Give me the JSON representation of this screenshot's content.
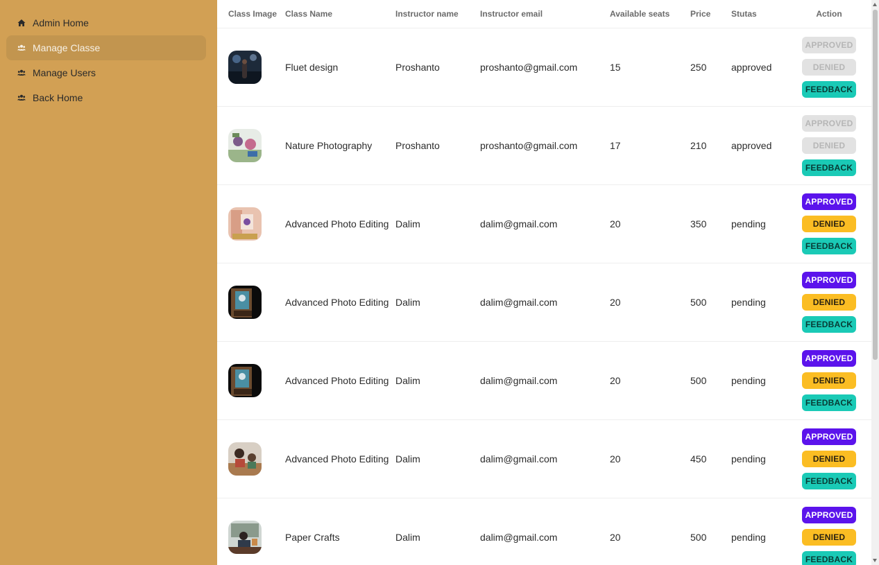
{
  "sidebar": {
    "items": [
      {
        "label": "Admin Home",
        "icon": "home-icon",
        "active": false
      },
      {
        "label": "Manage Classe",
        "icon": "users-icon",
        "active": true
      },
      {
        "label": "Manage Users",
        "icon": "users-icon",
        "active": false
      },
      {
        "label": "Back Home",
        "icon": "users-icon",
        "active": false
      }
    ]
  },
  "table": {
    "headers": [
      "Class Image",
      "Class Name",
      "Instructor name",
      "Instructor email",
      "Available seats",
      "Price",
      "Stutas",
      "Action"
    ],
    "rows": [
      {
        "image": "concert-photo",
        "class_name": "Fluet design",
        "instructor": "Proshanto",
        "email": "proshanto@gmail.com",
        "seats": "15",
        "price": "250",
        "status": "approved"
      },
      {
        "image": "nature-photo",
        "class_name": "Nature Photography",
        "instructor": "Proshanto",
        "email": "proshanto@gmail.com",
        "seats": "17",
        "price": "210",
        "status": "approved"
      },
      {
        "image": "painting-photo",
        "class_name": "Advanced Photo Editing",
        "instructor": "Dalim",
        "email": "dalim@gmail.com",
        "seats": "20",
        "price": "350",
        "status": "pending"
      },
      {
        "image": "easel-photo",
        "class_name": "Advanced Photo Editing",
        "instructor": "Dalim",
        "email": "dalim@gmail.com",
        "seats": "20",
        "price": "500",
        "status": "pending"
      },
      {
        "image": "easel-photo",
        "class_name": "Advanced Photo Editing",
        "instructor": "Dalim",
        "email": "dalim@gmail.com",
        "seats": "20",
        "price": "500",
        "status": "pending"
      },
      {
        "image": "kids-craft-photo",
        "class_name": "Advanced Photo Editing",
        "instructor": "Dalim",
        "email": "dalim@gmail.com",
        "seats": "20",
        "price": "450",
        "status": "pending"
      },
      {
        "image": "desk-photo",
        "class_name": "Paper Crafts",
        "instructor": "Dalim",
        "email": "dalim@gmail.com",
        "seats": "20",
        "price": "500",
        "status": "pending"
      }
    ]
  },
  "actions": {
    "approve_label": "APPROVED",
    "deny_label": "DENIED",
    "feedback_label": "FEEDBACK"
  },
  "colors": {
    "sidebar_bg": "#D2A054",
    "active_item_bg": "#C2954F",
    "approve": "#5B13EC",
    "deny": "#FBBD23",
    "feedback": "#1ACAB6",
    "disabled": "#E2E2E2"
  }
}
